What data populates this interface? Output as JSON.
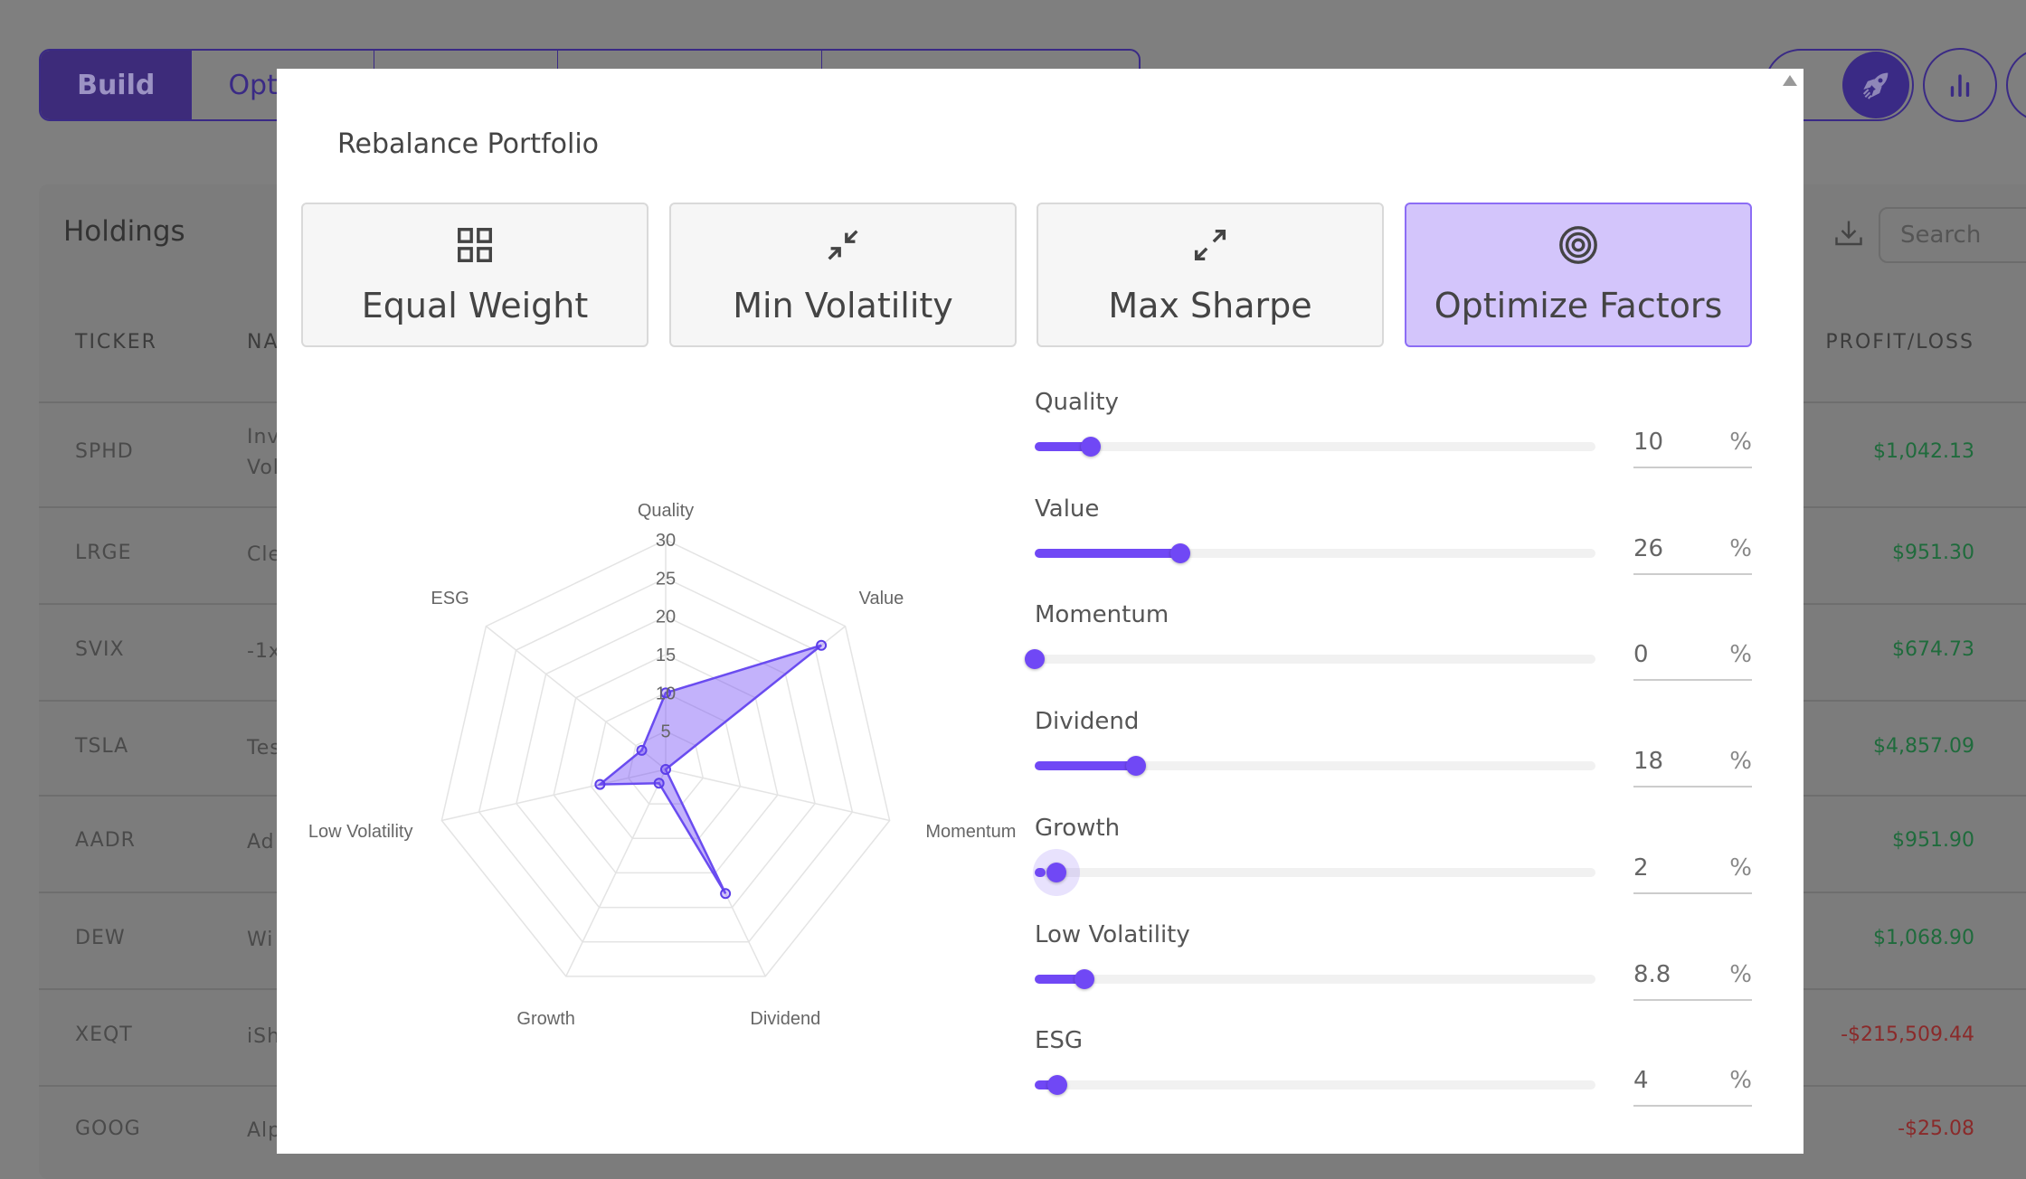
{
  "nav": {
    "tabs": [
      {
        "label": "Build",
        "active": true
      },
      {
        "label": "Opt"
      },
      {
        "label": ""
      },
      {
        "label": ""
      },
      {
        "label": ""
      }
    ]
  },
  "holdings": {
    "title": "Holdings",
    "search_placeholder": "Search",
    "columns": [
      "TICKER",
      "NA",
      "PROFIT/LOSS"
    ],
    "rows": [
      {
        "ticker": "SPHD",
        "name": "Inv\nVol",
        "pl": "$1,042.13",
        "positive": true
      },
      {
        "ticker": "LRGE",
        "name": "Cle",
        "pl": "$951.30",
        "positive": true
      },
      {
        "ticker": "SVIX",
        "name": "-1x",
        "pl": "$674.73",
        "positive": true
      },
      {
        "ticker": "TSLA",
        "name": "Tes",
        "pl": "$4,857.09",
        "positive": true
      },
      {
        "ticker": "AADR",
        "name": "Ad",
        "pl": "$951.90",
        "positive": true
      },
      {
        "ticker": "DEW",
        "name": "Wi",
        "pl": "$1,068.90",
        "positive": true
      },
      {
        "ticker": "XEQT",
        "name": "iSh",
        "pl": "-$215,509.44",
        "positive": false
      },
      {
        "ticker": "GOOG",
        "name": "Alp",
        "pl": "-$25.08",
        "positive": false
      }
    ]
  },
  "modal": {
    "title": "Rebalance Portfolio",
    "strategies": [
      {
        "label": "Equal Weight",
        "icon": "grid-icon"
      },
      {
        "label": "Min Volatility",
        "icon": "compress-icon"
      },
      {
        "label": "Max Sharpe",
        "icon": "expand-icon"
      },
      {
        "label": "Optimize Factors",
        "icon": "target-icon",
        "active": true
      }
    ],
    "factors": [
      {
        "label": "Quality",
        "value": "10",
        "num": 10
      },
      {
        "label": "Value",
        "value": "26",
        "num": 26
      },
      {
        "label": "Momentum",
        "value": "0",
        "num": 0
      },
      {
        "label": "Dividend",
        "value": "18",
        "num": 18
      },
      {
        "label": "Growth",
        "value": "2",
        "num": 2,
        "focused": true
      },
      {
        "label": "Low Volatility",
        "value": "8.8",
        "num": 8.8
      },
      {
        "label": "ESG",
        "value": "4",
        "num": 4
      }
    ],
    "unit": "%",
    "slider_max": 100
  },
  "colors": {
    "accent": "#7048f5",
    "positive": "#1f6b3c",
    "negative": "#8a2a2a"
  },
  "chart_data": {
    "type": "radar",
    "axes": [
      "Quality",
      "Value",
      "Momentum",
      "Dividend",
      "Growth",
      "Low Volatility",
      "ESG"
    ],
    "values": [
      10,
      26,
      0,
      18,
      2,
      8.8,
      4
    ],
    "r_range": [
      0,
      30
    ],
    "ticks": [
      "5",
      "10",
      "15",
      "20",
      "25",
      "30"
    ],
    "tick_values": [
      5,
      10,
      15,
      20,
      25,
      30
    ],
    "grid": true
  }
}
